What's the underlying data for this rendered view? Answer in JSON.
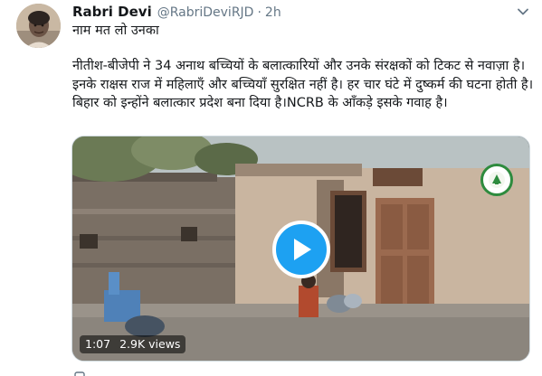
{
  "tweet": {
    "author_name": "Rabri Devi",
    "author_handle": "@RabriDeviRJD",
    "separator": "·",
    "timestamp": "2h",
    "line1": "नाम मत लो उनका",
    "body": "नीतीश-बीजेपी ने 34 अनाथ बच्चियों के बलात्कारियों और उनके संरक्षकों को टिकट से नवाज़ा है। इनके राक्षस राज में महिलाएँ और बच्चियाँ सुरक्षित नहीं है। हर चार घंटे में दुष्कर्म की घटना होती है। बिहार को इन्होंने बलात्कार प्रदेश बना दिया है।NCRB के आँकड़े इसके गवाह है।"
  },
  "video": {
    "duration": "1:07",
    "views": "2.9K views",
    "play_icon": "play-icon",
    "accent_color": "#1da1f2"
  },
  "icons": {
    "more": "chevron-down-icon",
    "party_logo": "party-logo-icon"
  }
}
